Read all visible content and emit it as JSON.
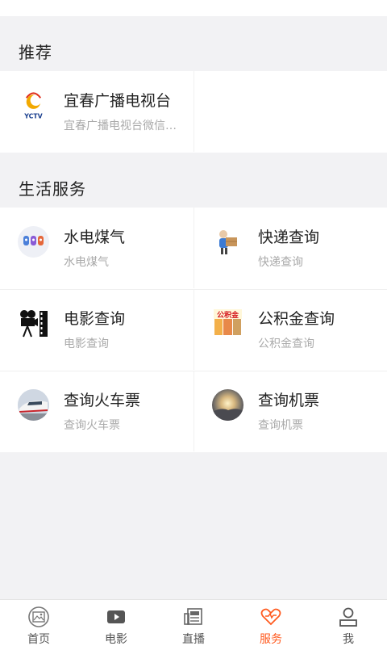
{
  "sections": {
    "recommend": {
      "title": "推荐",
      "items": [
        {
          "title": "宜春广播电视台",
          "subtitle": "宜春广播电视台微信公众号",
          "icon": "yctv-logo-icon"
        }
      ]
    },
    "life": {
      "title": "生活服务",
      "items": [
        {
          "title": "水电煤气",
          "subtitle": "水电煤气",
          "icon": "utilities-icon"
        },
        {
          "title": "快递查询",
          "subtitle": "快递查询",
          "icon": "courier-icon"
        },
        {
          "title": "电影查询",
          "subtitle": "电影查询",
          "icon": "film-camera-icon"
        },
        {
          "title": "公积金查询",
          "subtitle": "公积金查询",
          "icon": "housing-fund-icon"
        },
        {
          "title": "查询火车票",
          "subtitle": "查询火车票",
          "icon": "train-icon"
        },
        {
          "title": "查询机票",
          "subtitle": "查询机票",
          "icon": "flight-icon"
        }
      ]
    }
  },
  "tabbar": {
    "active": "服务",
    "accent_color": "#ff5a1f",
    "tabs": [
      {
        "label": "首页",
        "icon": "picture-icon"
      },
      {
        "label": "电影",
        "icon": "play-icon"
      },
      {
        "label": "直播",
        "icon": "newspaper-icon"
      },
      {
        "label": "服务",
        "icon": "heart-icon"
      },
      {
        "label": "我",
        "icon": "user-icon"
      }
    ]
  },
  "yctv_logo_text": "YCTV",
  "fund_icon_text": "公积金"
}
